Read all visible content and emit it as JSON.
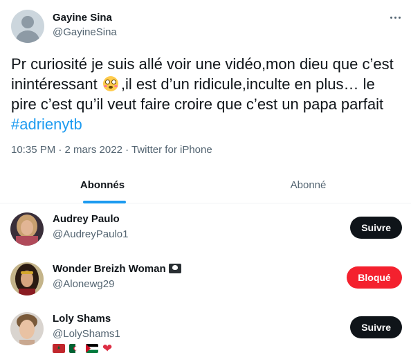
{
  "tweet": {
    "author_name": "Gayine Sina",
    "author_handle": "@GayineSina",
    "text_part1": "Pr curiosité je suis allé voir une vidéo,mon dieu que c’est inintéressant ",
    "text_part2": ",il est d’un ridicule,inculte en plus… le pire c’est qu’il veut faire croire que c’est un papa parfait ",
    "hashtag": "#adrienytb",
    "meta": "10:35 PM · 2 mars 2022 · Twitter for iPhone",
    "inline_emoji": "flushed-face-emoji",
    "more_icon": "more-horizontal-icon"
  },
  "tabs": [
    {
      "label": "Abonnés",
      "active": true
    },
    {
      "label": "Abonné",
      "active": false
    }
  ],
  "users": [
    {
      "name": "Audrey Paulo",
      "handle": "@AudreyPaulo1",
      "button": "Suivre",
      "button_style": "follow"
    },
    {
      "name": "Wonder Breizh Woman",
      "name_badge_icon": "skull-crossbones-flag-icon",
      "handle": "@Alonewg29",
      "button": "Bloqué",
      "button_style": "blocked"
    },
    {
      "name": "Loly Shams",
      "handle": "@LolyShams1",
      "button": "Suivre",
      "button_style": "follow",
      "bio_icons": [
        "morocco-flag-icon",
        "algeria-flag-icon",
        "palestine-flag-icon",
        "red-heart-icon"
      ]
    }
  ],
  "colors": {
    "accent": "#1d9bf0",
    "follow_button": "#0f1419",
    "blocked_button": "#f4212e",
    "secondary_text": "#536471"
  }
}
